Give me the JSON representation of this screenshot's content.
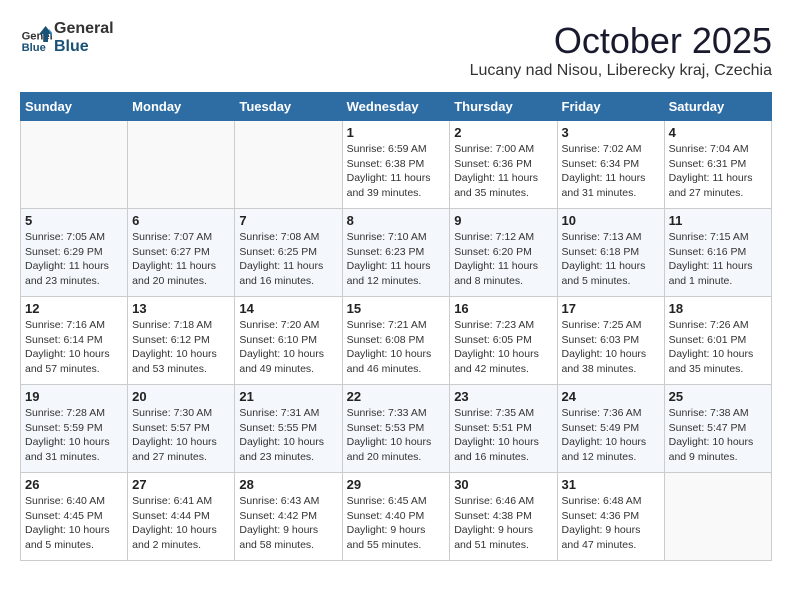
{
  "header": {
    "logo_general": "General",
    "logo_blue": "Blue",
    "title": "October 2025",
    "subtitle": "Lucany nad Nisou, Liberecky kraj, Czechia"
  },
  "calendar": {
    "days_of_week": [
      "Sunday",
      "Monday",
      "Tuesday",
      "Wednesday",
      "Thursday",
      "Friday",
      "Saturday"
    ],
    "weeks": [
      [
        {
          "day": "",
          "info": ""
        },
        {
          "day": "",
          "info": ""
        },
        {
          "day": "",
          "info": ""
        },
        {
          "day": "1",
          "info": "Sunrise: 6:59 AM\nSunset: 6:38 PM\nDaylight: 11 hours\nand 39 minutes."
        },
        {
          "day": "2",
          "info": "Sunrise: 7:00 AM\nSunset: 6:36 PM\nDaylight: 11 hours\nand 35 minutes."
        },
        {
          "day": "3",
          "info": "Sunrise: 7:02 AM\nSunset: 6:34 PM\nDaylight: 11 hours\nand 31 minutes."
        },
        {
          "day": "4",
          "info": "Sunrise: 7:04 AM\nSunset: 6:31 PM\nDaylight: 11 hours\nand 27 minutes."
        }
      ],
      [
        {
          "day": "5",
          "info": "Sunrise: 7:05 AM\nSunset: 6:29 PM\nDaylight: 11 hours\nand 23 minutes."
        },
        {
          "day": "6",
          "info": "Sunrise: 7:07 AM\nSunset: 6:27 PM\nDaylight: 11 hours\nand 20 minutes."
        },
        {
          "day": "7",
          "info": "Sunrise: 7:08 AM\nSunset: 6:25 PM\nDaylight: 11 hours\nand 16 minutes."
        },
        {
          "day": "8",
          "info": "Sunrise: 7:10 AM\nSunset: 6:23 PM\nDaylight: 11 hours\nand 12 minutes."
        },
        {
          "day": "9",
          "info": "Sunrise: 7:12 AM\nSunset: 6:20 PM\nDaylight: 11 hours\nand 8 minutes."
        },
        {
          "day": "10",
          "info": "Sunrise: 7:13 AM\nSunset: 6:18 PM\nDaylight: 11 hours\nand 5 minutes."
        },
        {
          "day": "11",
          "info": "Sunrise: 7:15 AM\nSunset: 6:16 PM\nDaylight: 11 hours\nand 1 minute."
        }
      ],
      [
        {
          "day": "12",
          "info": "Sunrise: 7:16 AM\nSunset: 6:14 PM\nDaylight: 10 hours\nand 57 minutes."
        },
        {
          "day": "13",
          "info": "Sunrise: 7:18 AM\nSunset: 6:12 PM\nDaylight: 10 hours\nand 53 minutes."
        },
        {
          "day": "14",
          "info": "Sunrise: 7:20 AM\nSunset: 6:10 PM\nDaylight: 10 hours\nand 49 minutes."
        },
        {
          "day": "15",
          "info": "Sunrise: 7:21 AM\nSunset: 6:08 PM\nDaylight: 10 hours\nand 46 minutes."
        },
        {
          "day": "16",
          "info": "Sunrise: 7:23 AM\nSunset: 6:05 PM\nDaylight: 10 hours\nand 42 minutes."
        },
        {
          "day": "17",
          "info": "Sunrise: 7:25 AM\nSunset: 6:03 PM\nDaylight: 10 hours\nand 38 minutes."
        },
        {
          "day": "18",
          "info": "Sunrise: 7:26 AM\nSunset: 6:01 PM\nDaylight: 10 hours\nand 35 minutes."
        }
      ],
      [
        {
          "day": "19",
          "info": "Sunrise: 7:28 AM\nSunset: 5:59 PM\nDaylight: 10 hours\nand 31 minutes."
        },
        {
          "day": "20",
          "info": "Sunrise: 7:30 AM\nSunset: 5:57 PM\nDaylight: 10 hours\nand 27 minutes."
        },
        {
          "day": "21",
          "info": "Sunrise: 7:31 AM\nSunset: 5:55 PM\nDaylight: 10 hours\nand 23 minutes."
        },
        {
          "day": "22",
          "info": "Sunrise: 7:33 AM\nSunset: 5:53 PM\nDaylight: 10 hours\nand 20 minutes."
        },
        {
          "day": "23",
          "info": "Sunrise: 7:35 AM\nSunset: 5:51 PM\nDaylight: 10 hours\nand 16 minutes."
        },
        {
          "day": "24",
          "info": "Sunrise: 7:36 AM\nSunset: 5:49 PM\nDaylight: 10 hours\nand 12 minutes."
        },
        {
          "day": "25",
          "info": "Sunrise: 7:38 AM\nSunset: 5:47 PM\nDaylight: 10 hours\nand 9 minutes."
        }
      ],
      [
        {
          "day": "26",
          "info": "Sunrise: 6:40 AM\nSunset: 4:45 PM\nDaylight: 10 hours\nand 5 minutes."
        },
        {
          "day": "27",
          "info": "Sunrise: 6:41 AM\nSunset: 4:44 PM\nDaylight: 10 hours\nand 2 minutes."
        },
        {
          "day": "28",
          "info": "Sunrise: 6:43 AM\nSunset: 4:42 PM\nDaylight: 9 hours\nand 58 minutes."
        },
        {
          "day": "29",
          "info": "Sunrise: 6:45 AM\nSunset: 4:40 PM\nDaylight: 9 hours\nand 55 minutes."
        },
        {
          "day": "30",
          "info": "Sunrise: 6:46 AM\nSunset: 4:38 PM\nDaylight: 9 hours\nand 51 minutes."
        },
        {
          "day": "31",
          "info": "Sunrise: 6:48 AM\nSunset: 4:36 PM\nDaylight: 9 hours\nand 47 minutes."
        },
        {
          "day": "",
          "info": ""
        }
      ]
    ]
  }
}
